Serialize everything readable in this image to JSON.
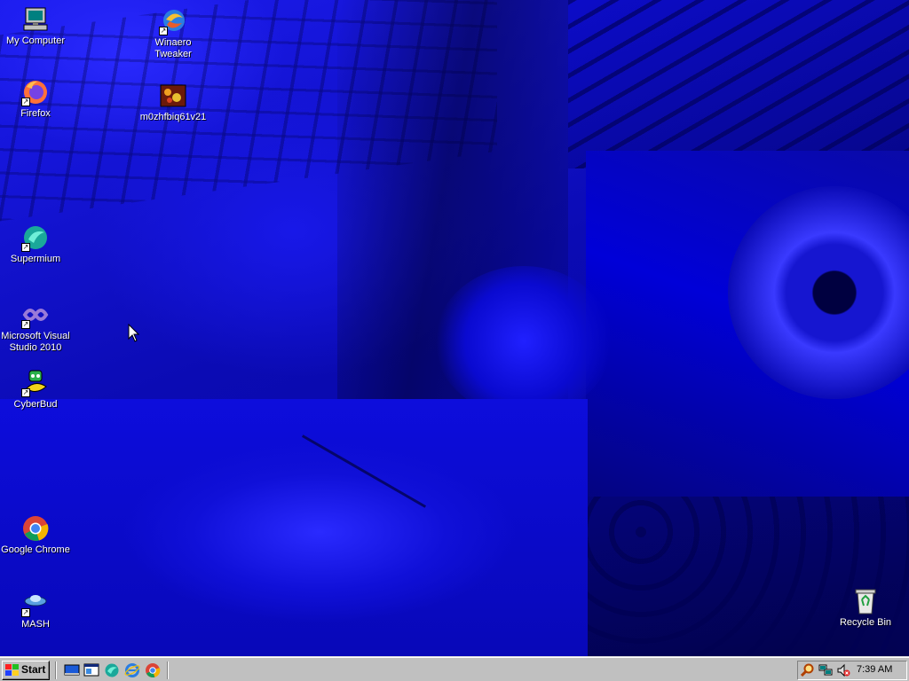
{
  "desktop": {
    "icons": [
      {
        "label": "My Computer"
      },
      {
        "label": "Winaero Tweaker"
      },
      {
        "label": "Firefox"
      },
      {
        "label": "m0zhfbiq61v21"
      },
      {
        "label": "Supermium"
      },
      {
        "label": "Microsoft Visual Studio 2010"
      },
      {
        "label": "CyberBud"
      },
      {
        "label": "Google Chrome"
      },
      {
        "label": "MASH"
      },
      {
        "label": "Recycle Bin"
      }
    ]
  },
  "taskbar": {
    "start_label": "Start",
    "quick_launch": [
      {
        "icon": "show-desktop-icon"
      },
      {
        "icon": "explorer-window-icon"
      },
      {
        "icon": "supermium-icon"
      },
      {
        "icon": "internet-explorer-icon"
      },
      {
        "icon": "chrome-icon"
      }
    ],
    "tray": {
      "icons": [
        "search-icon",
        "network-icon",
        "volume-muted-icon"
      ],
      "clock": "7:39 AM"
    }
  },
  "colors": {
    "desktop_blue": "#06069a",
    "taskbar_gray": "#c0c0c0",
    "label_text": "#ffffff"
  }
}
